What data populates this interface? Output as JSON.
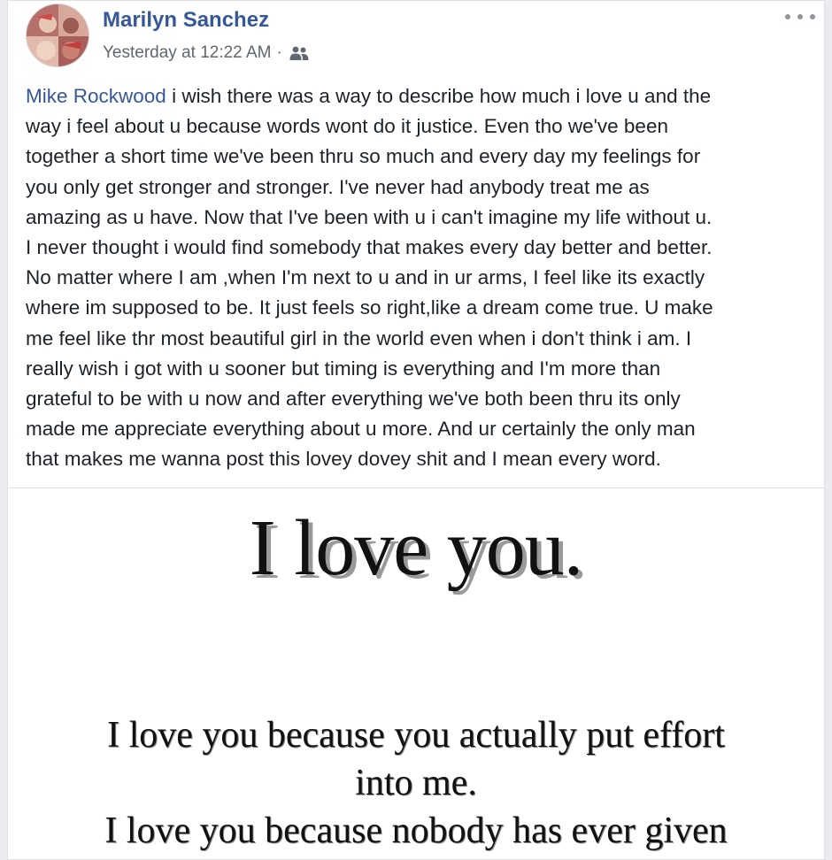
{
  "post": {
    "author": "Marilyn Sanchez",
    "timestamp": "Yesterday at 12:22 AM",
    "separator": "·",
    "audience_icon": "friends-icon",
    "more_icon": "more-options-icon",
    "mention": "Mike Rockwood",
    "text_lines": [
      " i wish there was a way to describe how much i love u and the",
      "way i feel about u because words wont do it justice. Even tho we've been",
      "together a short time we've been thru so much and every day my feelings for",
      "you only get stronger and stronger. I've never had anybody treat me as",
      "amazing as u have. Now that I've been with u i can't imagine my life without u.",
      "I never thought i would find somebody that makes every day better and better.",
      "No matter where I am ,when I'm next to u and in ur arms, I feel like its exactly",
      "where im supposed to be. It just feels so right,like a dream come true. U make",
      "me feel like thr most beautiful girl in the world even when i don't think i am. I",
      "really wish i got with u sooner but timing is everything and I'm more than",
      "grateful to be with u now and after everything we've both been thru its only",
      "made me appreciate everything about u more. And ur certainly the only man",
      "that makes me wanna post this lovey dovey shit and I mean every word."
    ]
  },
  "image": {
    "headline": "I love you.",
    "body_lines": [
      "I love you because you actually put effort",
      "into me.",
      "I love you because nobody has ever given"
    ]
  },
  "colors": {
    "link": "#365899",
    "text": "#1d2129",
    "meta": "#616770",
    "background": "#e9ebee"
  }
}
